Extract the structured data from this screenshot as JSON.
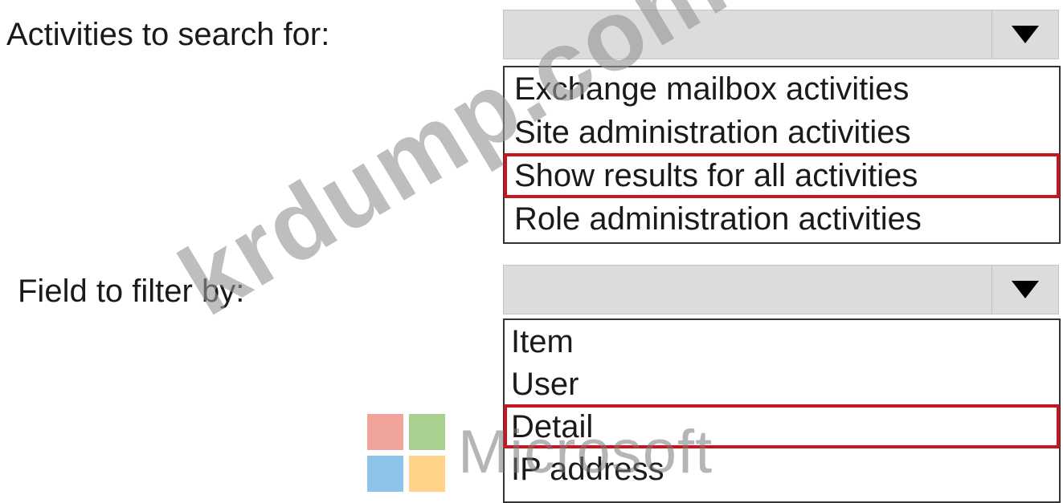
{
  "labels": {
    "activities": "Activities to search for:",
    "field": "Field to filter by:"
  },
  "activities_select": {
    "value": "",
    "icon": "triangle-down-icon",
    "options": [
      {
        "label": "Exchange mailbox activities",
        "selected": false
      },
      {
        "label": "Site administration activities",
        "selected": false
      },
      {
        "label": "Show results for all activities",
        "selected": true
      },
      {
        "label": "Role administration activities",
        "selected": false
      }
    ]
  },
  "field_select": {
    "value": "",
    "icon": "triangle-down-icon",
    "options": [
      {
        "label": "Item",
        "selected": false
      },
      {
        "label": "User",
        "selected": false
      },
      {
        "label": "Detail",
        "selected": true
      },
      {
        "label": "IP address",
        "selected": false
      }
    ]
  },
  "colors": {
    "selection_outline": "#c9151e",
    "select_background": "#dcdcdc",
    "logo_red": "#f1a59a",
    "logo_green": "#a9d08e",
    "logo_blue": "#8ec3ea",
    "logo_yellow": "#ffd38a"
  },
  "logo": {
    "text": "Microsoft"
  },
  "watermark": {
    "text": "krdump.com"
  }
}
